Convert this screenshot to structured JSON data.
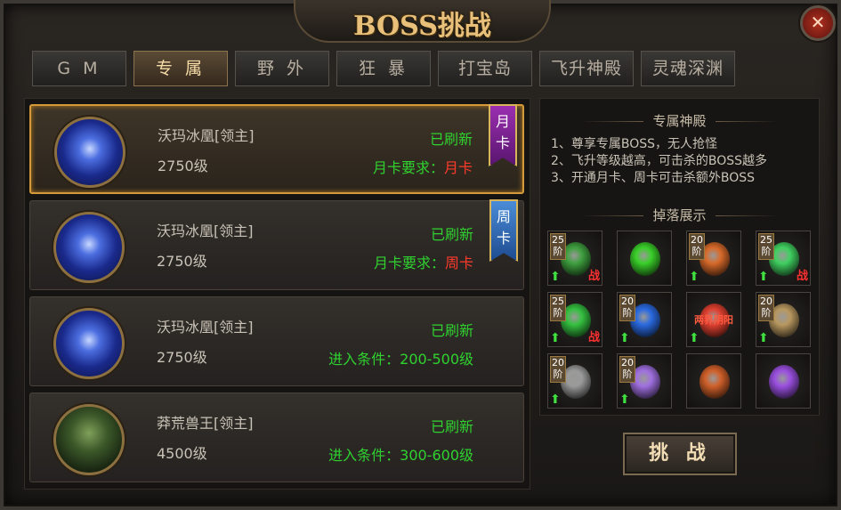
{
  "window": {
    "title": "BOSS挑战",
    "close_label": "✕"
  },
  "tabs": [
    {
      "label": "G M",
      "active": false
    },
    {
      "label": "专 属",
      "active": true
    },
    {
      "label": "野 外",
      "active": false
    },
    {
      "label": "狂 暴",
      "active": false
    },
    {
      "label": "打宝岛",
      "active": false
    },
    {
      "label": "飞升神殿",
      "active": false
    },
    {
      "label": "灵魂深渊",
      "active": false
    }
  ],
  "bosses": [
    {
      "name": "沃玛冰凰[领主]",
      "level": "2750级",
      "status": "已刷新",
      "req_label": "月卡要求：",
      "req_value": "月卡",
      "ribbon": "月卡",
      "ribbon_color": "#9a2fb0",
      "art": "ice",
      "selected": true
    },
    {
      "name": "沃玛冰凰[领主]",
      "level": "2750级",
      "status": "已刷新",
      "req_label": "月卡要求：",
      "req_value": "周卡",
      "ribbon": "周卡",
      "ribbon_color": "#4a8cd8",
      "art": "ice",
      "selected": false
    },
    {
      "name": "沃玛冰凰[领主]",
      "level": "2750级",
      "status": "已刷新",
      "req_label": "进入条件：200-500级",
      "req_value": "",
      "ribbon": "",
      "art": "ice",
      "selected": false
    },
    {
      "name": "莽荒兽王[领主]",
      "level": "4500级",
      "status": "已刷新",
      "req_label": "进入条件：300-600级",
      "req_value": "",
      "ribbon": "",
      "art": "beast",
      "selected": false
    }
  ],
  "info": {
    "section_title": "专属神殿",
    "rules": [
      "1、尊享专属BOSS，无人抢怪",
      "2、飞升等级越高，可击杀的BOSS越多",
      "3、开通月卡、周卡可击杀额外BOSS"
    ],
    "drops_title": "掉落展示"
  },
  "drops": [
    {
      "name": "armor-item",
      "stage": "25阶",
      "up": true,
      "zhan": "战",
      "color": "#3fa03f"
    },
    {
      "name": "green-gem-item",
      "stage": "",
      "up": false,
      "zhan": "",
      "color": "#3ad02a"
    },
    {
      "name": "ring-item",
      "stage": "20阶",
      "up": true,
      "zhan": "",
      "color": "#d86a2a"
    },
    {
      "name": "bow-item",
      "stage": "25阶",
      "up": true,
      "zhan": "战",
      "color": "#40d060"
    },
    {
      "name": "bracelet-item",
      "stage": "25阶",
      "up": true,
      "zhan": "战",
      "color": "#35c040"
    },
    {
      "name": "blue-orb-item",
      "stage": "20阶",
      "up": true,
      "zhan": "",
      "color": "#2a6ae0"
    },
    {
      "name": "title-item",
      "stage": "",
      "up": true,
      "zhan": "",
      "color": "#e04030",
      "text": "两界阴阳"
    },
    {
      "name": "helmet-item",
      "stage": "20阶",
      "up": true,
      "zhan": "",
      "color": "#b89860"
    },
    {
      "name": "hat-item",
      "stage": "20阶",
      "up": true,
      "zhan": "",
      "color": "#9a9a9a"
    },
    {
      "name": "wings-item",
      "stage": "20阶",
      "up": true,
      "zhan": "",
      "color": "#a070e0"
    },
    {
      "name": "gift-box-item",
      "stage": "",
      "up": false,
      "zhan": "",
      "color": "#d0602a"
    },
    {
      "name": "purple-crystal-item",
      "stage": "",
      "up": false,
      "zhan": "",
      "color": "#9a50e0"
    }
  ],
  "challenge_button": "挑 战"
}
